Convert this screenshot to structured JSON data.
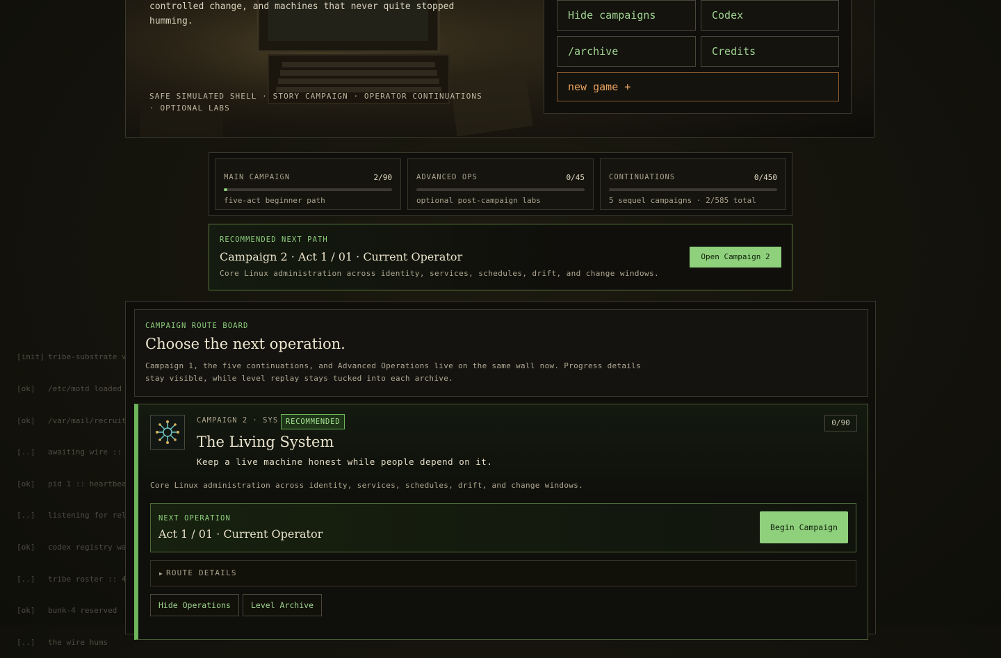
{
  "hero": {
    "description_lines": [
      "controlled change, and machines that never quite stopped",
      "humming."
    ],
    "tagline": "SAFE SIMULATED SHELL · STORY CAMPAIGN · OPERATOR CONTINUATIONS · OPTIONAL LABS"
  },
  "menu": {
    "hide_campaigns": "Hide campaigns",
    "codex": "Codex",
    "archive": "/archive",
    "credits": "Credits",
    "new_game_plus": "new game +"
  },
  "stats": [
    {
      "label": "MAIN CAMPAIGN",
      "count": "2/90",
      "progress": 0.022,
      "sub": "five-act beginner path"
    },
    {
      "label": "ADVANCED OPS",
      "count": "0/45",
      "progress": 0,
      "sub": "optional post-campaign labs"
    },
    {
      "label": "CONTINUATIONS",
      "count": "0/450",
      "progress": 0,
      "sub": "5 sequel campaigns · 2/585 total"
    }
  ],
  "recommended": {
    "kicker": "RECOMMENDED NEXT PATH",
    "title": "Campaign 2 · Act 1 / 01 · Current Operator",
    "description": "Core Linux administration across identity, services, schedules, drift, and change windows.",
    "button": "Open Campaign 2"
  },
  "board": {
    "kicker": "CAMPAIGN ROUTE BOARD",
    "title": "Choose the next operation.",
    "description": "Campaign 1, the five continuations, and Advanced Operations live on the same wall now. Progress details stay visible, while level replay stays tucked into each archive."
  },
  "campaign": {
    "meta": "CAMPAIGN 2 · SYS",
    "badge": "RECOMMENDED",
    "count": "0/90",
    "title": "The Living System",
    "tagline": "Keep a live machine honest while people depend on it.",
    "description": "Core Linux administration across identity, services, schedules, drift, and change windows.",
    "next_kicker": "NEXT OPERATION",
    "next_title": "Act 1 / 01 · Current Operator",
    "begin_button": "Begin Campaign",
    "route_details": "ROUTE DETAILS",
    "hide_operations": "Hide Operations",
    "level_archive": "Level Archive",
    "icon": "network-hub-icon"
  },
  "bootlog": [
    {
      "tag": "[init]",
      "text": "tribe-substrate v"
    },
    {
      "tag": "[ok]",
      "text": "/etc/motd loaded"
    },
    {
      "tag": "[ok]",
      "text": "/var/mail/recruit"
    },
    {
      "tag": "[..]",
      "text": "awaiting wire ::"
    },
    {
      "tag": "[ok]",
      "text": "pid 1 :: heartbea"
    },
    {
      "tag": "[..]",
      "text": "listening for rel"
    },
    {
      "tag": "[ok]",
      "text": "codex registry wa"
    },
    {
      "tag": "[..]",
      "text": "tribe roster :: 4"
    },
    {
      "tag": "[ok]",
      "text": "bunk-4 reserved"
    },
    {
      "tag": "[..]",
      "text": "the wire hums"
    }
  ],
  "colors": {
    "accent": "#8fd07c",
    "orange": "#e7a15c",
    "background": "#14130c"
  }
}
